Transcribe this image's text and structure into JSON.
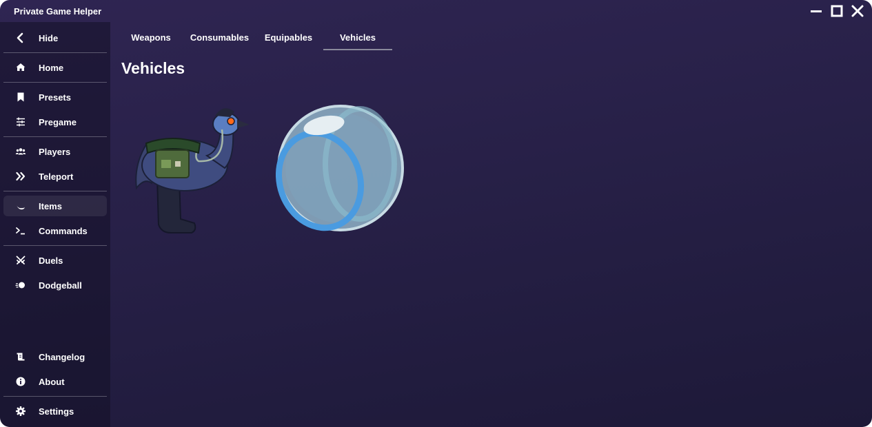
{
  "window": {
    "title": "Private Game Helper"
  },
  "sidebar": {
    "items": [
      {
        "label": "Hide",
        "icon": "chevron-left-icon"
      },
      {
        "label": "Home",
        "icon": "home-icon"
      },
      {
        "label": "Presets",
        "icon": "bookmark-icon"
      },
      {
        "label": "Pregame",
        "icon": "sliders-icon"
      },
      {
        "label": "Players",
        "icon": "users-icon"
      },
      {
        "label": "Teleport",
        "icon": "double-chevron-right-icon"
      },
      {
        "label": "Items",
        "icon": "moon-icon",
        "active": true
      },
      {
        "label": "Commands",
        "icon": "terminal-icon"
      },
      {
        "label": "Duels",
        "icon": "crossed-swords-icon"
      },
      {
        "label": "Dodgeball",
        "icon": "ball-icon"
      },
      {
        "label": "Changelog",
        "icon": "scroll-icon"
      },
      {
        "label": "About",
        "icon": "info-icon"
      },
      {
        "label": "Settings",
        "icon": "gear-icon"
      }
    ]
  },
  "tabs": [
    {
      "label": "Weapons"
    },
    {
      "label": "Consumables"
    },
    {
      "label": "Equipables"
    },
    {
      "label": "Vehicles",
      "active": true
    }
  ],
  "main": {
    "title": "Vehicles",
    "vehicles": [
      {
        "icon": "emu-mount-icon"
      },
      {
        "icon": "hamster-ball-icon"
      }
    ]
  }
}
